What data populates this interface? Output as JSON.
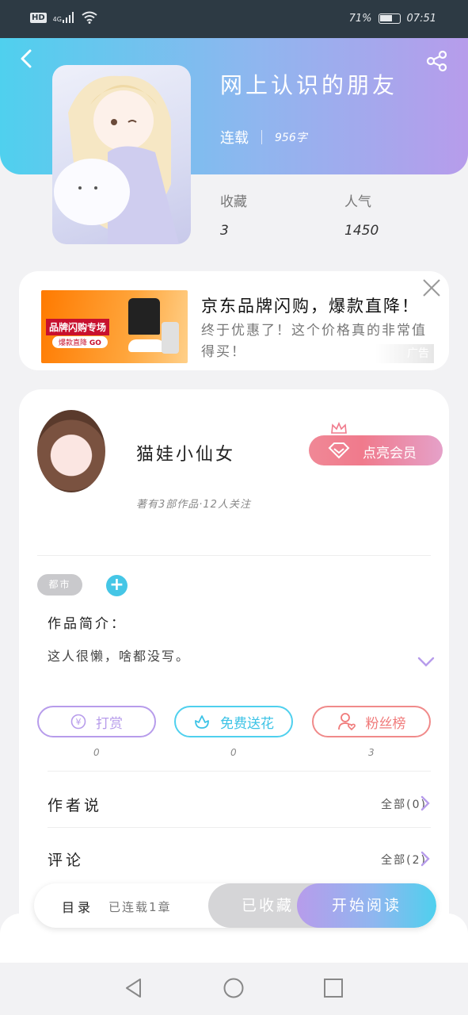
{
  "status": {
    "signal_label": "4G",
    "hd": "HD",
    "battery": "71%",
    "time": "07:51"
  },
  "book": {
    "title": "网上认识的朋友",
    "status": "连载",
    "words": "956字",
    "collect_label": "收藏",
    "collect_value": "3",
    "popularity_label": "人气",
    "popularity_value": "1450"
  },
  "ad": {
    "title": "京东品牌闪购，爆款直降！",
    "desc": "终于优惠了！这个价格真的非常值得买！",
    "image_badge": "品牌闪购专场",
    "image_button": "爆款直降",
    "image_go": "GO",
    "tag": "广告"
  },
  "author": {
    "name": "猫娃小仙女",
    "info": "著有3部作品·12人关注",
    "vip_button": "点亮会员"
  },
  "tags": [
    {
      "label": "都市"
    }
  ],
  "intro": {
    "label": "作品简介：",
    "text": "这人很懒，啥都没写。"
  },
  "actions": [
    {
      "label": "打赏",
      "count": "0"
    },
    {
      "label": "免费送花",
      "count": "0"
    },
    {
      "label": "粉丝榜",
      "count": "3"
    }
  ],
  "sections": [
    {
      "label": "作者说",
      "right": "全部(0)"
    },
    {
      "label": "评论",
      "right": "全部(2)"
    }
  ],
  "bottom": {
    "catalog": "目录",
    "serial": "已连载1章",
    "collected": "已收藏",
    "start_read": "开始阅读"
  },
  "colors": {
    "accent_cyan": "#4fd0ee",
    "accent_purple": "#b79ceb",
    "pink": "#f07a8c"
  }
}
